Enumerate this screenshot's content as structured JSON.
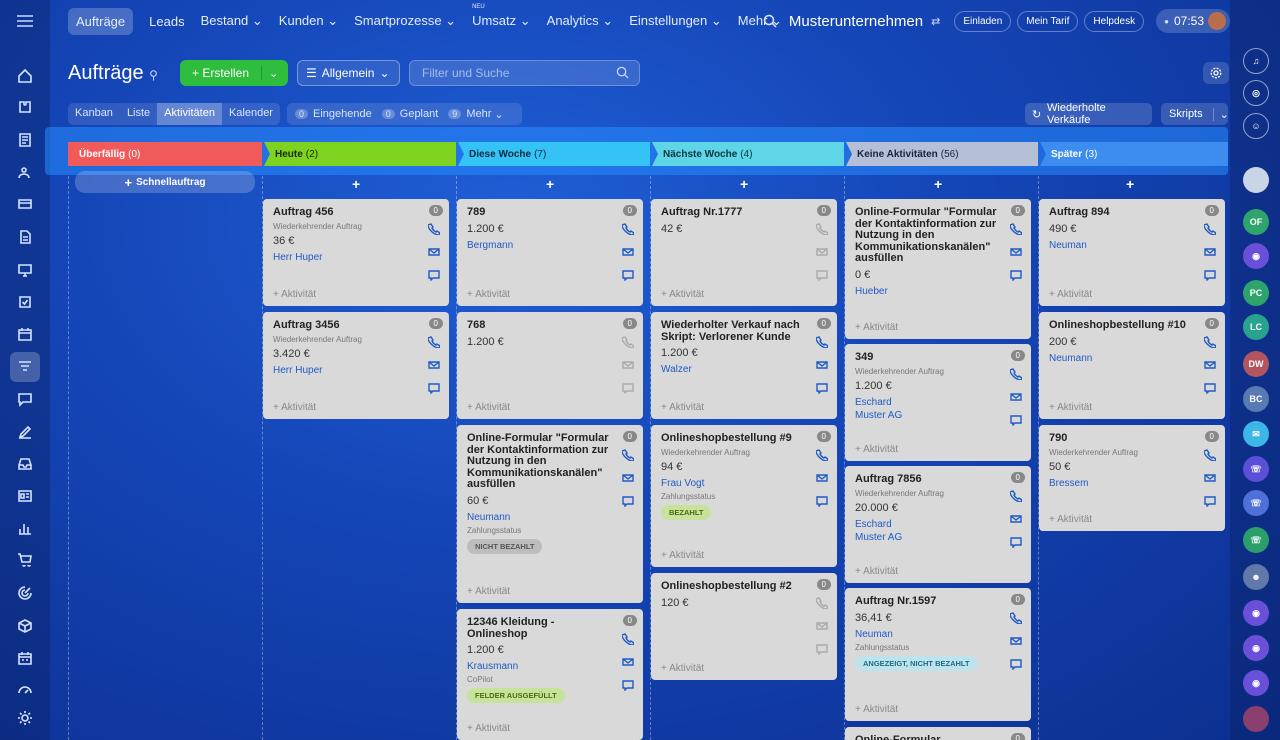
{
  "topnav": {
    "items": [
      "Aufträge",
      "Leads",
      "Bestand",
      "Kunden",
      "Smartprozesse",
      "Umsatz",
      "Analytics",
      "Einstellungen",
      "Mehr"
    ],
    "new_badge": "NEU",
    "company": "Musterunternehmen",
    "invite": "Einladen",
    "tariff": "Mein Tarif",
    "helpdesk": "Helpdesk",
    "time": "07:53"
  },
  "header": {
    "title": "Aufträge",
    "create_label": "Erstellen",
    "filter_label": "Allgemein",
    "search_placeholder": "Filter und Suche"
  },
  "view_tabs": [
    "Kanban",
    "Liste",
    "Aktivitäten",
    "Kalender"
  ],
  "counters": {
    "incoming": {
      "count": "0",
      "label": "Eingehende"
    },
    "planned": {
      "count": "0",
      "label": "Geplant"
    },
    "more": {
      "count": "9",
      "label": "Mehr"
    }
  },
  "right_buttons": {
    "repeat": "Wiederholte Verkäufe",
    "scripts": "Skripts"
  },
  "quick_order": "Schnellauftrag",
  "add_activity": "+ Aktivität",
  "columns": [
    {
      "name": "Überfällig",
      "count": "(0)",
      "color": "#f15a5a",
      "text_color": "#ffffff",
      "cards": []
    },
    {
      "name": "Heute",
      "count": "(2)",
      "color": "#7ed321",
      "text_color": "#1a2a00",
      "cards": [
        {
          "title": "Auftrag 456",
          "sub": "Wiederkehrender Auftrag",
          "amount": "36 €",
          "contact": "Herr Huper",
          "num": "0"
        },
        {
          "title": "Auftrag 3456",
          "sub": "Wiederkehrender Auftrag",
          "amount": "3.420 €",
          "contact": "Herr Huper",
          "num": "0"
        }
      ]
    },
    {
      "name": "Diese Woche",
      "count": "(7)",
      "color": "#35c3f5",
      "text_color": "#0a2a40",
      "cards": [
        {
          "title": "789",
          "amount": "1.200 €",
          "contact": "Bergmann",
          "num": "0"
        },
        {
          "title": "768",
          "amount": "1.200 €",
          "num": "0"
        },
        {
          "title": "Online-Formular \"Formular der Kontaktinformation zur Nutzung in den Kommunikationskanälen\" ausfüllen",
          "amount": "60 €",
          "contact": "Neumann",
          "field": "Zahlungsstatus",
          "badge": "NICHT BEZAHLT",
          "badge_color": "#bdbdbd",
          "badge_text": "#555555",
          "num": "0"
        },
        {
          "title": "12346 Kleidung - Onlineshop",
          "amount": "1.200 €",
          "contact": "Krausmann",
          "field": "CoPilot",
          "badge": "FELDER AUSGEFÜLLT",
          "badge_color": "#c7e29a",
          "badge_text": "#4a6a10",
          "num": "0"
        }
      ]
    },
    {
      "name": "Nächste Woche",
      "count": "(4)",
      "color": "#5fd6e8",
      "text_color": "#0a3540",
      "cards": [
        {
          "title": "Auftrag Nr.1777",
          "amount": "42 €",
          "num": "0"
        },
        {
          "title": "Wiederholter Verkauf nach Skript: Verlorener Kunde",
          "amount": "1.200 €",
          "contact": "Walzer",
          "num": "0"
        },
        {
          "title": "Onlineshopbestellung #9",
          "sub": "Wiederkehrender Auftrag",
          "amount": "94 €",
          "contact": "Frau Vogt",
          "field": "Zahlungsstatus",
          "badge": "BEZAHLT",
          "badge_color": "#c7e29a",
          "badge_text": "#4a6a10",
          "num": "0"
        },
        {
          "title": "Onlineshopbestellung #2",
          "amount": "120 €",
          "num": "0"
        }
      ]
    },
    {
      "name": "Keine Aktivitäten",
      "count": "(56)",
      "color": "#b5c0d6",
      "text_color": "#1a2340",
      "cards": [
        {
          "title": "Online-Formular \"Formular der Kontaktinformation zur Nutzung in den Kommunikationskanälen\" ausfüllen",
          "amount": "0 €",
          "contact": "Hueber",
          "num": "0"
        },
        {
          "title": "349",
          "sub": "Wiederkehrender Auftrag",
          "amount": "1.200 €",
          "contact": "Eschard",
          "contact2": "Muster AG",
          "num": "0"
        },
        {
          "title": "Auftrag 7856",
          "sub": "Wiederkehrender Auftrag",
          "amount": "20.000 €",
          "contact": "Eschard",
          "contact2": "Muster AG",
          "num": "0"
        },
        {
          "title": "Auftrag Nr.1597",
          "amount": "36,41 €",
          "contact": "Neuman",
          "field": "Zahlungsstatus",
          "badge": "ANGEZEIGT, NICHT BEZAHLT",
          "badge_color": "#bfe3ec",
          "badge_text": "#1f6c80",
          "num": "0"
        },
        {
          "title": "Online-Formular",
          "num": "0"
        }
      ]
    },
    {
      "name": "Später",
      "count": "(3)",
      "color": "#3d8df0",
      "text_color": "#ffffff",
      "cards": [
        {
          "title": "Auftrag 894",
          "amount": "490 €",
          "contact": "Neuman",
          "num": "0"
        },
        {
          "title": "Onlineshopbestellung #10",
          "amount": "200 €",
          "contact": "Neumann",
          "num": "0"
        },
        {
          "title": "790",
          "sub": "Wiederkehrender Auftrag",
          "amount": "50 €",
          "contact": "Bressem",
          "num": "0"
        }
      ]
    }
  ],
  "right_avatars": [
    "OF",
    "PC",
    "LC",
    "DW",
    "BC"
  ]
}
